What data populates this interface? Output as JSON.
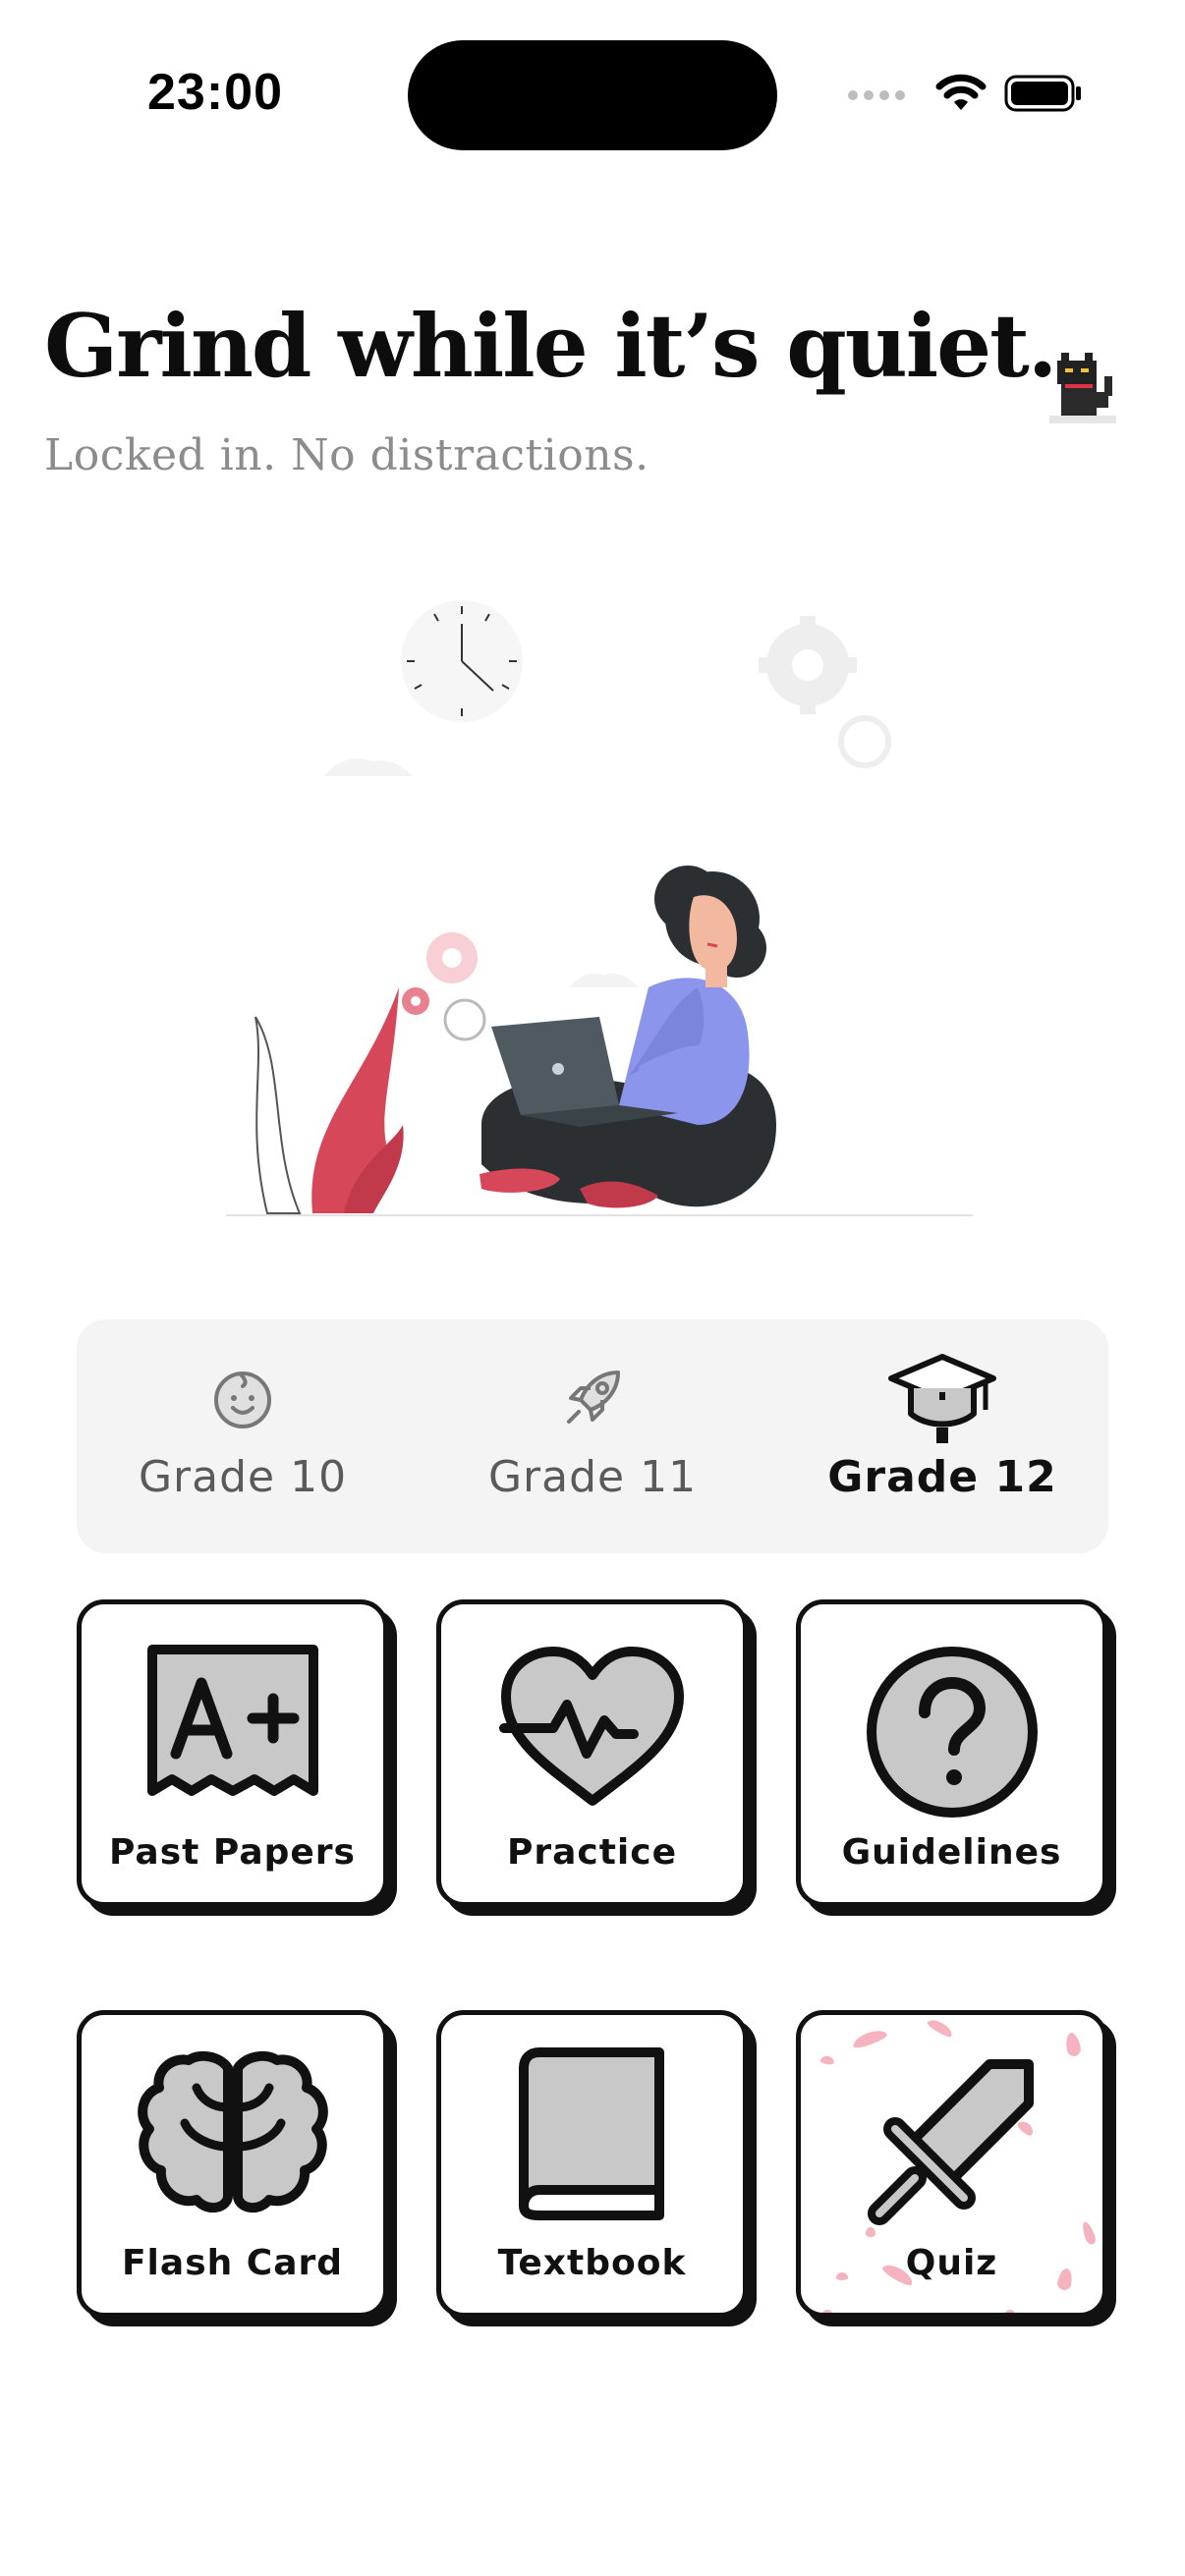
{
  "status_bar": {
    "time": "23:00"
  },
  "header": {
    "title": "Grind while it’s quiet.",
    "subtitle": "Locked in. No distractions."
  },
  "grades": {
    "items": [
      {
        "label": "Grade 10",
        "icon": "baby-face-icon",
        "active": false
      },
      {
        "label": "Grade 11",
        "icon": "rocket-icon",
        "active": false
      },
      {
        "label": "Grade 12",
        "icon": "graduation-cap-icon",
        "active": true
      }
    ]
  },
  "cards": {
    "items": [
      {
        "label": "Past Papers",
        "icon": "graded-paper-icon"
      },
      {
        "label": "Practice",
        "icon": "heart-pulse-icon"
      },
      {
        "label": "Guidelines",
        "icon": "question-circle-icon"
      },
      {
        "label": "Flash Card",
        "icon": "brain-icon"
      },
      {
        "label": "Textbook",
        "icon": "book-icon"
      },
      {
        "label": "Quiz",
        "icon": "sword-icon"
      }
    ]
  },
  "colors": {
    "accent_blue": "#8b95ec",
    "accent_red": "#d7475a",
    "petal_pink": "#f2a6b4",
    "card_border": "#111111",
    "icon_fill": "#c8c8c8"
  }
}
